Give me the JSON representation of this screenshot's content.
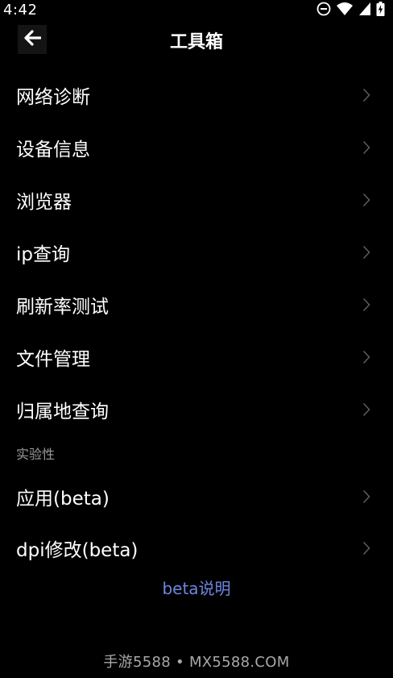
{
  "status_bar": {
    "time": "4:42",
    "icons": [
      "do-not-disturb-icon",
      "wifi-icon",
      "signal-icon",
      "battery-icon"
    ]
  },
  "app_bar": {
    "title": "工具箱",
    "back_icon": "arrow-left-icon"
  },
  "menu": {
    "items": [
      {
        "label": "网络诊断"
      },
      {
        "label": "设备信息"
      },
      {
        "label": "浏览器"
      },
      {
        "label": "ip查询"
      },
      {
        "label": "刷新率测试"
      },
      {
        "label": "文件管理"
      },
      {
        "label": "归属地查询"
      }
    ]
  },
  "experimental": {
    "section_label": "实验性",
    "items": [
      {
        "label": "应用(beta)"
      },
      {
        "label": "dpi修改(beta)"
      }
    ]
  },
  "beta_link": {
    "label": "beta说明"
  },
  "watermark": {
    "text": "手游5588 • MX5588.COM"
  },
  "colors": {
    "background": "#000000",
    "text": "#ffffff",
    "section_label": "#9a9a9a",
    "link": "#6f86e0",
    "chevron": "#5a5a5a"
  }
}
